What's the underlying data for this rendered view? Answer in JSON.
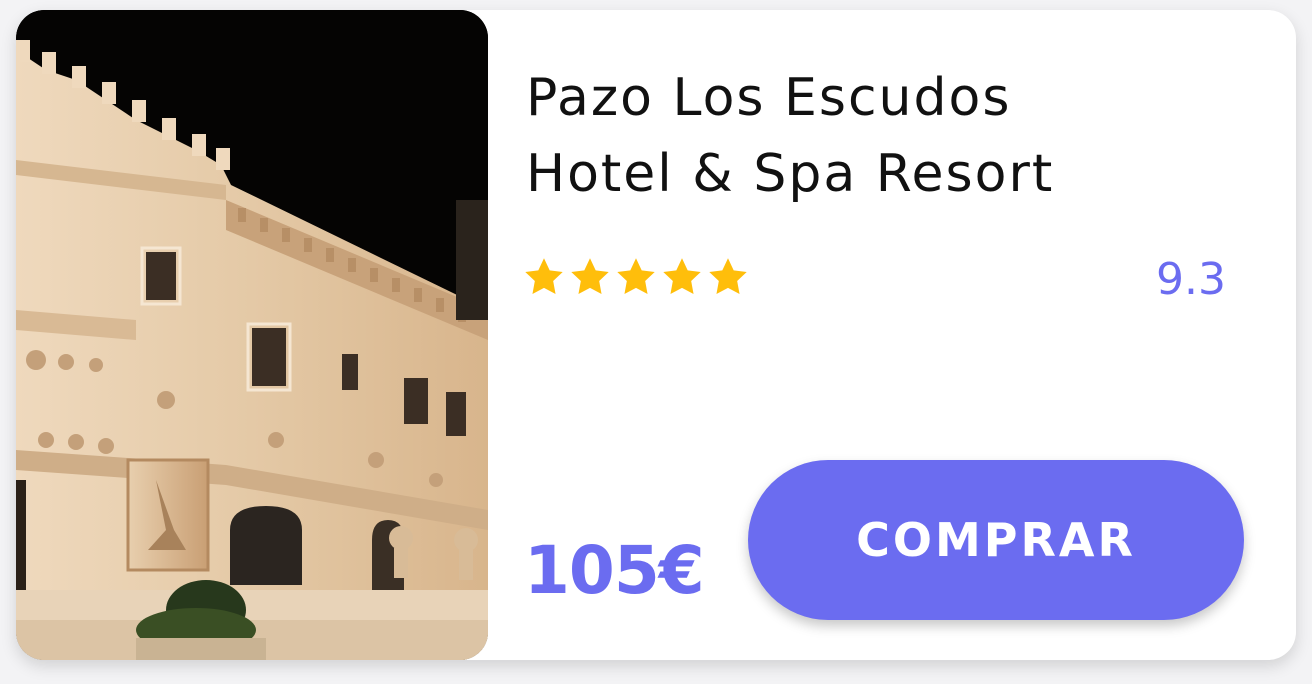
{
  "hotel": {
    "name_line1": "Pazo Los Escudos",
    "name_line2": "Hotel & Spa Resort",
    "stars": 5,
    "rating": "9.3",
    "price": "105€"
  },
  "actions": {
    "buy_label": "COMPRAR"
  },
  "colors": {
    "accent": "#6b6cf0",
    "star": "#ffbe0b",
    "title_text": "#111111"
  },
  "icons": {
    "rating_star": "star-icon"
  }
}
